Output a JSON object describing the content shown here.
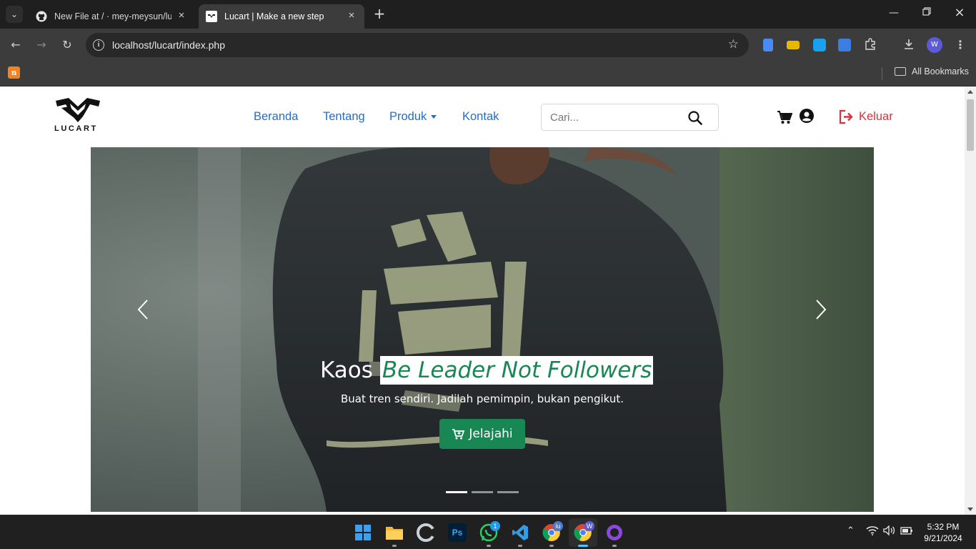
{
  "browser": {
    "tabs": [
      {
        "title": "New File at / · mey-meysun/luca",
        "favicon": "github-icon",
        "active": false
      },
      {
        "title": "Lucart | Make a new step",
        "favicon": "lucart-favicon-icon",
        "active": true
      }
    ],
    "url": "localhost/lucart/index.php",
    "bookmarks_label": "All Bookmarks",
    "profile_initial": "W"
  },
  "site": {
    "logo_text": "LUCART",
    "nav": {
      "beranda": "Beranda",
      "tentang": "Tentang",
      "produk": "Produk",
      "kontak": "Kontak"
    },
    "search_placeholder": "Cari...",
    "logout_label": "Keluar",
    "colors": {
      "link": "#1f6fd1",
      "logout": "#d9323f",
      "accent": "#198754"
    }
  },
  "carousel": {
    "title_prefix": "Kaos",
    "title_highlight": "Be Leader Not Followers",
    "subtitle": "Buat tren sendiri. Jadilah pemimpin, bukan pengikut.",
    "cta_label": "Jelajahi",
    "slide_count": 3,
    "active_slide": 1
  },
  "taskbar": {
    "whatsapp_badge": "1",
    "chrome_badge": "iu",
    "chrome_active_badge": "W",
    "time": "5:32 PM",
    "date": "9/21/2024"
  }
}
